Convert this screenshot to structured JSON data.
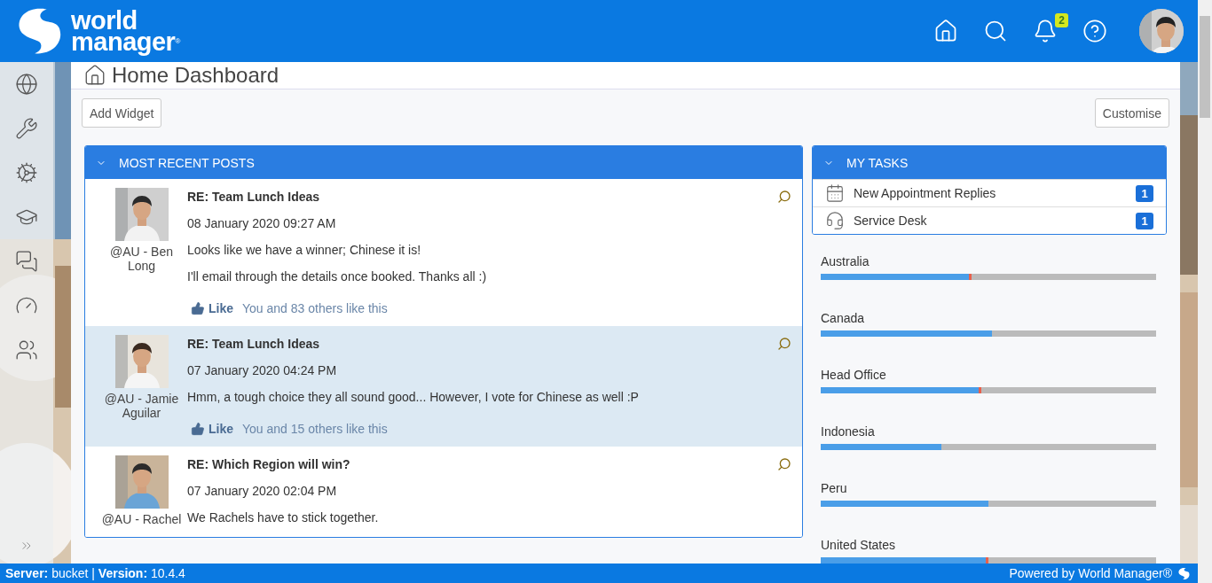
{
  "header": {
    "logo": {
      "line1": "world",
      "line2": "manager",
      "mark": "®"
    },
    "notification_count": "2"
  },
  "page": {
    "title": "Home Dashboard"
  },
  "toolbar": {
    "buttons": [
      {
        "label": "Add Widget"
      },
      {
        "label": "Customise"
      }
    ]
  },
  "posts_widget": {
    "title": "MOST RECENT POSTS",
    "posts": [
      {
        "author": "@AU - Ben Long",
        "title": "RE: Team Lunch Ideas",
        "date": "08 January 2020 09:27 AM",
        "paragraphs": [
          "Looks like we have a winner; Chinese it is!",
          "I'll email through the details once booked. Thanks all :)"
        ],
        "like_label": "Like",
        "likes": "You and 83 others like this",
        "highlighted": false
      },
      {
        "author": "@AU - Jamie Aguilar",
        "title": "RE: Team Lunch Ideas",
        "date": "07 January 2020 04:24 PM",
        "paragraphs": [
          "Hmm, a tough choice they all sound good... However, I vote for Chinese as well :P"
        ],
        "like_label": "Like",
        "likes": "You and 15 others like this",
        "highlighted": true
      },
      {
        "author": "@AU - Rachel",
        "title": "RE: Which Region will win?",
        "date": "07 January 2020 02:04 PM",
        "paragraphs": [
          "We Rachels have to stick together."
        ],
        "highlighted": false
      }
    ]
  },
  "tasks_widget": {
    "title": "MY TASKS",
    "items": [
      {
        "kind": "calendar",
        "label": "New Appointment Replies",
        "count": "1"
      },
      {
        "kind": "headset",
        "label": "Service Desk",
        "count": "1"
      }
    ]
  },
  "regions": [
    {
      "name": "Australia",
      "level": 0.45,
      "marked": true
    },
    {
      "name": "Canada",
      "level": 0.51,
      "marked": false
    },
    {
      "name": "Head Office",
      "level": 0.48,
      "marked": true
    },
    {
      "name": "Indonesia",
      "level": 0.36,
      "marked": false
    },
    {
      "name": "Peru",
      "level": 0.5,
      "marked": false
    },
    {
      "name": "United States",
      "level": 0.5,
      "marked": true
    }
  ],
  "footer": {
    "server_info": "**Server:** bucket |  **Version:** 10.4.4",
    "powered_by": "Powered by World Manager®"
  }
}
